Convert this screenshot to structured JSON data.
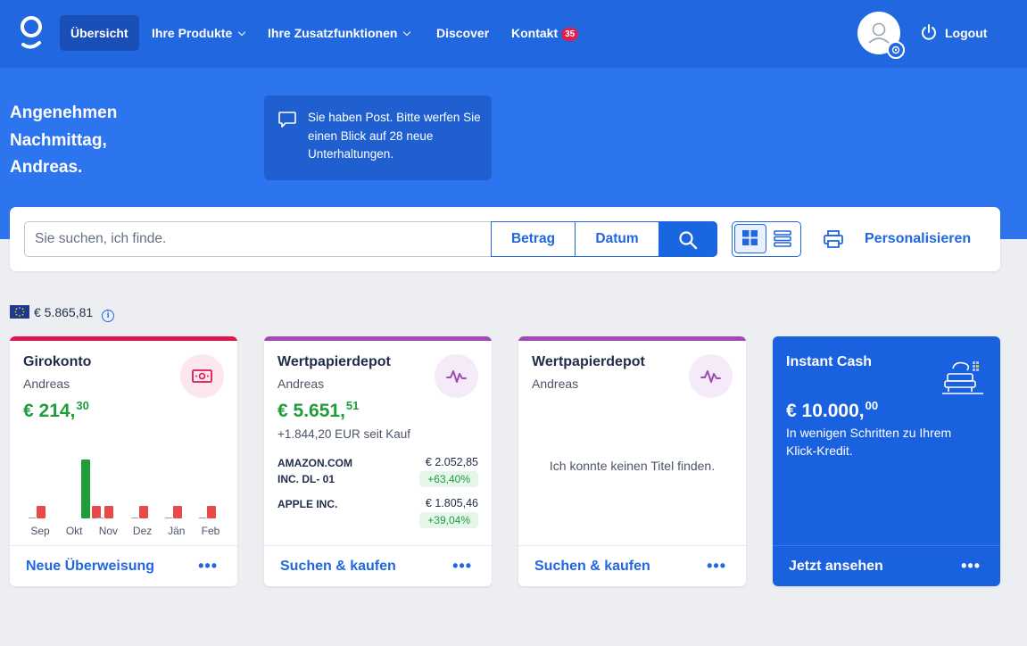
{
  "nav": {
    "items": [
      {
        "label": "Übersicht"
      },
      {
        "label": "Ihre Produkte"
      },
      {
        "label": "Ihre Zusatzfunktionen"
      },
      {
        "label": "Discover"
      },
      {
        "label": "Kontakt",
        "badge": "35"
      }
    ],
    "logout": "Logout"
  },
  "hero": {
    "greeting": [
      "Angenehmen",
      "Nachmittag,",
      "Andreas."
    ],
    "message": "Sie haben Post. Bitte werfen Sie einen Blick auf 28 neue Unterhaltungen."
  },
  "search": {
    "placeholder": "Sie suchen, ich finde.",
    "filter_amount": "Betrag",
    "filter_date": "Datum",
    "personalize": "Personalisieren"
  },
  "summary": {
    "total": "€ 5.865,81"
  },
  "cards": [
    {
      "title": "Girokonto",
      "owner": "Andreas",
      "amount_main": "€ 214,",
      "amount_cents": "30",
      "action": "Neue Überweisung",
      "more": "•••",
      "chart_data": {
        "type": "bar",
        "categories": [
          "Sep",
          "Okt",
          "Nov",
          "Dez",
          "Jän",
          "Feb"
        ],
        "series": [
          {
            "values": [
              0,
              66,
              0,
              0,
              0,
              0
            ]
          },
          {
            "values": [
              14,
              14,
              14,
              14,
              14,
              14
            ]
          }
        ]
      }
    },
    {
      "title": "Wertpapierdepot",
      "owner": "Andreas",
      "amount_main": "€ 5.651,",
      "amount_cents": "51",
      "since": "+1.844,20 EUR seit Kauf",
      "positions": [
        {
          "name": "AMAZON.COM INC. DL- 01",
          "value": "€ 2.052,85",
          "change": "+63,40%"
        },
        {
          "name": "APPLE INC.",
          "value": "€ 1.805,46",
          "change": "+39,04%"
        }
      ],
      "action": "Suchen & kaufen",
      "more": "•••"
    },
    {
      "title": "Wertpapierdepot",
      "owner": "Andreas",
      "empty": "Ich konnte keinen Titel finden.",
      "action": "Suchen & kaufen",
      "more": "•••"
    },
    {
      "title": "Instant Cash",
      "amount_main": "€ 10.000,",
      "amount_cents": "00",
      "description": "In wenigen Schritten zu Ihrem Klick-Kredit.",
      "action": "Jetzt ansehen",
      "more": "•••"
    }
  ],
  "colors": {
    "nav_bg": "#2167e0",
    "hero_bg": "#2d75ee",
    "accent": "#2167e0",
    "positive": "#1f9d3a",
    "negative": "#e84a4a",
    "giro_bar": "#e0174f",
    "depot_bar": "#a04bb5"
  },
  "icons": {
    "logo": "brand-logo-icon",
    "avatar": "user-icon",
    "settings": "gear-icon",
    "logout": "power-icon",
    "message": "chat-bubble-icon",
    "search": "search-icon",
    "grid_view": "grid-view-icon",
    "list_view": "list-view-icon",
    "print": "printer-icon",
    "flag": "eu-flag-icon",
    "info": "info-icon",
    "giro": "banknote-icon",
    "depot": "activity-icon",
    "cash": "sofa-icon"
  }
}
